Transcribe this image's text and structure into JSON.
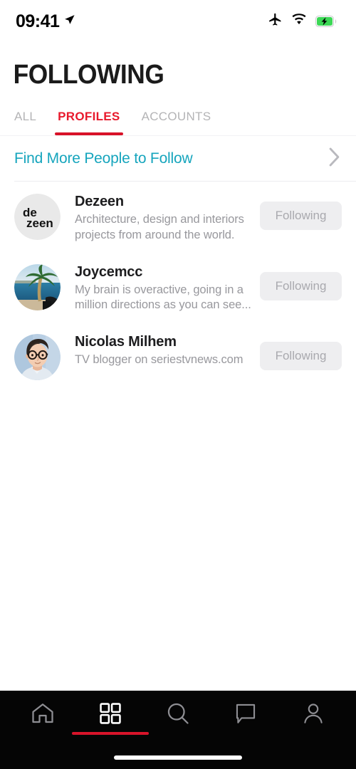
{
  "status_bar": {
    "time": "09:41",
    "location_icon": "location-arrow-icon",
    "airplane_icon": "airplane-mode-icon",
    "wifi_icon": "wifi-icon",
    "battery_icon": "battery-charging-icon",
    "battery_color": "#3cd856"
  },
  "header": {
    "title": "FOLLOWING"
  },
  "tabs": {
    "items": [
      {
        "label": "ALL",
        "active": false
      },
      {
        "label": "PROFILES",
        "active": true
      },
      {
        "label": "ACCOUNTS",
        "active": false
      }
    ],
    "active_color": "#e8192c",
    "inactive_color": "#b4b4b6"
  },
  "find_more": {
    "label": "Find More People to Follow",
    "color": "#16a5bd",
    "chevron_icon": "chevron-right-icon"
  },
  "list": {
    "items": [
      {
        "name": "Dezeen",
        "description": "Architecture, design and interiors projects from around the world.",
        "avatar": "dezeen-logo-avatar",
        "button_label": "Following"
      },
      {
        "name": "Joycemcc",
        "description": "My brain is overactive, going in a million directions as you can see...",
        "avatar": "beach-photo-avatar",
        "button_label": "Following"
      },
      {
        "name": "Nicolas Milhem",
        "description": "TV blogger on seriestvnews.com",
        "avatar": "man-illustration-avatar",
        "button_label": "Following"
      }
    ]
  },
  "bottom_nav": {
    "items": [
      {
        "icon": "home-icon",
        "active": false
      },
      {
        "icon": "grid-icon",
        "active": true
      },
      {
        "icon": "search-icon",
        "active": false
      },
      {
        "icon": "chat-bubble-icon",
        "active": false
      },
      {
        "icon": "profile-person-icon",
        "active": false
      }
    ],
    "indicator_color": "#d8142a"
  },
  "home_indicator": {
    "visible": true
  }
}
